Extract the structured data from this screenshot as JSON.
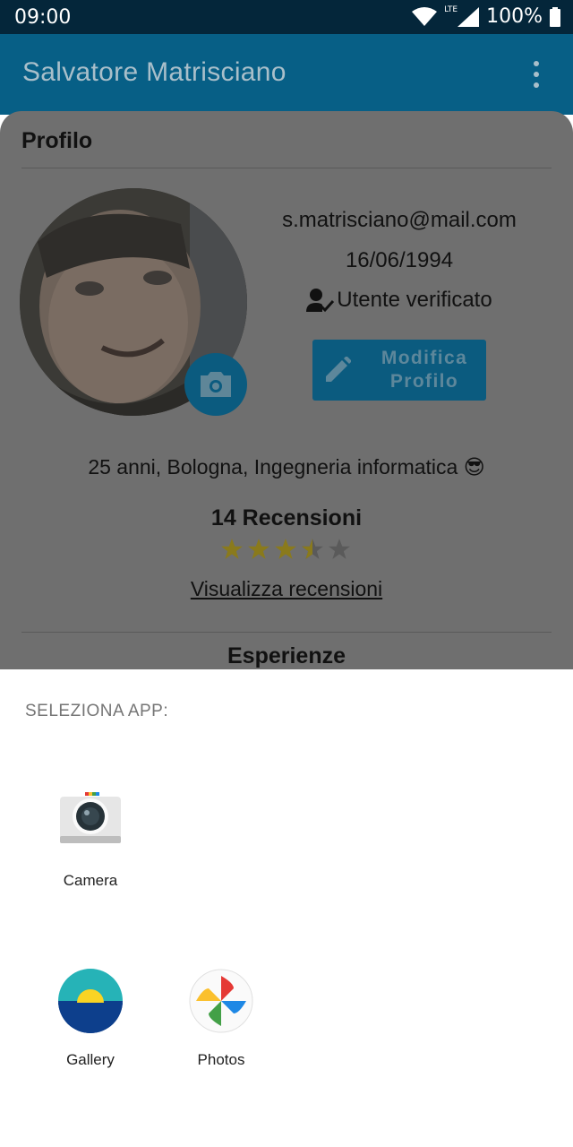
{
  "status_bar": {
    "time": "09:00",
    "network_label": "LTE",
    "battery": "100%"
  },
  "app_bar": {
    "title": "Salvatore  Matrisciano",
    "menu_icon": "more-vert-icon"
  },
  "profile": {
    "section_title": "Profilo",
    "email": "s.matrisciano@mail.com",
    "birthdate": "16/06/1994",
    "verified_label": "Utente verificato",
    "edit_button_line1": "Modifica",
    "edit_button_line2": "Profilo",
    "bio": "25 anni, Bologna, Ingegneria informatica 😎",
    "reviews_title": "14 Recensioni",
    "rating": 3.5,
    "rating_max": 5,
    "reviews_link": "Visualizza recensioni",
    "experiences_title": "Esperienze"
  },
  "chooser": {
    "title": "SELEZIONA APP:",
    "apps": [
      {
        "label": "Camera",
        "icon": "camera-app-icon"
      },
      {
        "label": "Gallery",
        "icon": "gallery-app-icon"
      },
      {
        "label": "Photos",
        "icon": "photos-app-icon"
      }
    ]
  },
  "colors": {
    "status_bar": "#04263a",
    "app_bar": "#075f86",
    "accent_dimmed": "#0b5b7f",
    "star": "#8a7a1c",
    "sheet_background": "#ffffff"
  }
}
